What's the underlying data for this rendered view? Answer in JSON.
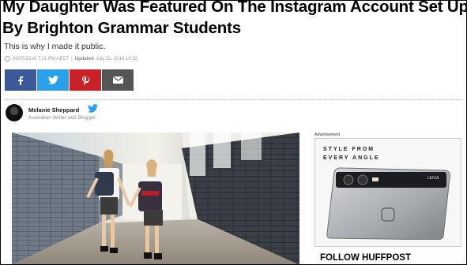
{
  "article": {
    "headline": "My Daughter Was Featured On The Instagram Account Set Up By Brighton Grammar Students",
    "subhead": "This is why I made it public.",
    "published": "20/07/2016 7:21 PM AEST",
    "updated_label": "Updated",
    "updated": "July 21, 2016 10:33"
  },
  "share": {
    "buttons": [
      {
        "network": "facebook",
        "icon": "facebook-icon",
        "color": "#3b5998"
      },
      {
        "network": "twitter",
        "icon": "twitter-icon",
        "color": "#2a9fea"
      },
      {
        "network": "pinterest",
        "icon": "pinterest-icon",
        "color": "#cb2027"
      },
      {
        "network": "email",
        "icon": "mail-icon",
        "color": "#555555"
      }
    ]
  },
  "author": {
    "name": "Melanie Sheppard",
    "title": "Australian Writer and Blogger"
  },
  "sidebar": {
    "ad_label": "Advertisement",
    "ad_text_line1": "STYLE FROM",
    "ad_text_line2": "EVERY ANGLE",
    "phone_brand": "LEICA",
    "follow_heading": "FOLLOW HUFFPOST"
  }
}
